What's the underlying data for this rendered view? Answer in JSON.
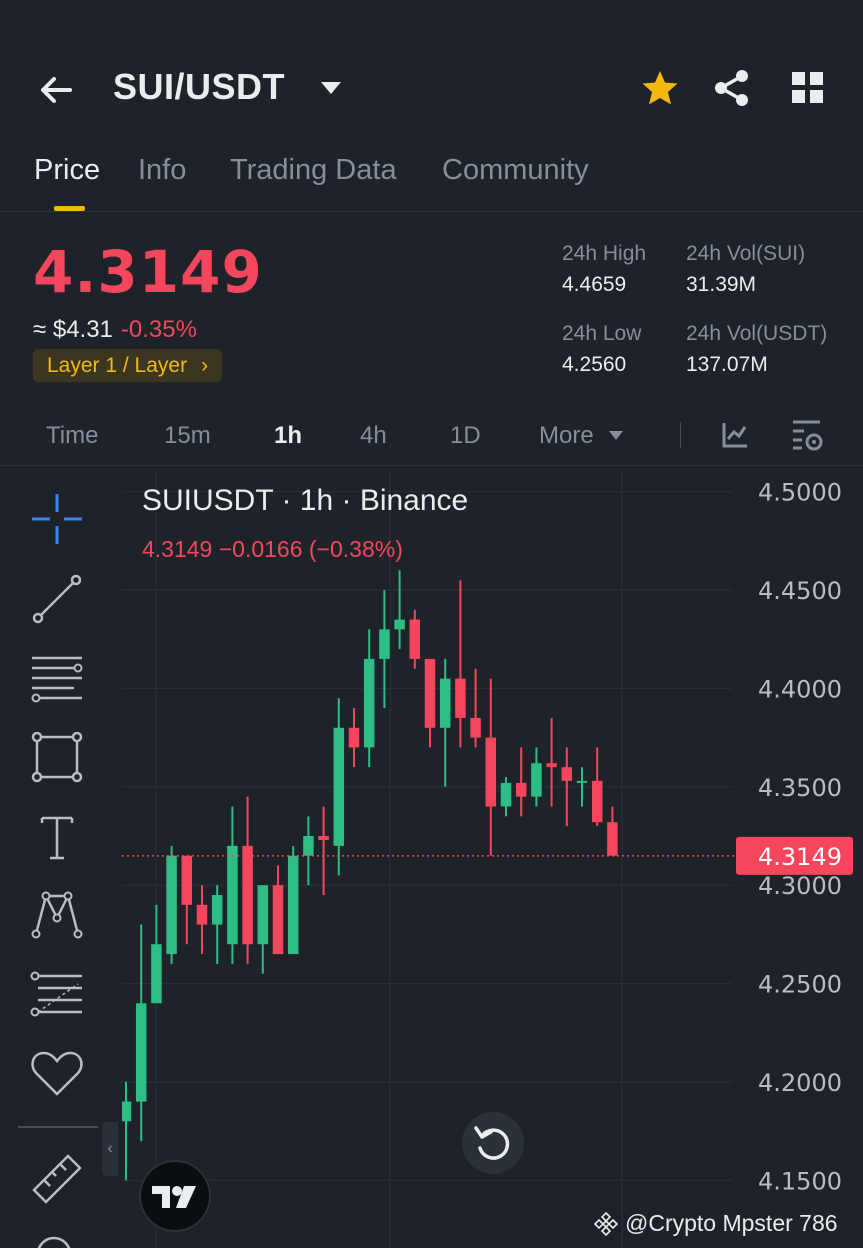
{
  "header": {
    "pair": "SUI/USDT",
    "icons": [
      "back-arrow-icon",
      "chevron-down-icon",
      "star-icon",
      "share-icon",
      "grid-icon"
    ]
  },
  "tabs": [
    "Price",
    "Info",
    "Trading Data",
    "Community"
  ],
  "ticker": {
    "last_price": "4.3149",
    "usd_equiv": "≈ $4.31",
    "change_pct": "-0.35%",
    "tag": "Layer 1 / Layer",
    "tag_arrow": "›",
    "high_label": "24h High",
    "high_value": "4.4659",
    "low_label": "24h Low",
    "low_value": "4.2560",
    "vol_sui_label": "24h Vol(SUI)",
    "vol_sui_value": "31.39M",
    "vol_usdt_label": "24h Vol(USDT)",
    "vol_usdt_value": "137.07M"
  },
  "intervals": {
    "items": [
      "Time",
      "15m",
      "1h",
      "4h",
      "1D",
      "More"
    ],
    "active": "1h"
  },
  "chart_header": {
    "title": "SUIUSDT · 1h · Binance",
    "ohlc_line": "4.3149  −0.0166 (−0.38%)"
  },
  "chart_data": {
    "type": "candlestick",
    "y_ticks": [
      "4.5000",
      "4.4500",
      "4.4000",
      "4.3500",
      "4.3000",
      "4.2500",
      "4.2000",
      "4.1500"
    ],
    "ylim": [
      4.14,
      4.51
    ],
    "last_price_label": "4.3149",
    "last_price": 4.3149,
    "candles": [
      {
        "o": 4.18,
        "h": 4.2,
        "l": 4.15,
        "c": 4.19
      },
      {
        "o": 4.19,
        "h": 4.28,
        "l": 4.17,
        "c": 4.24
      },
      {
        "o": 4.24,
        "h": 4.29,
        "l": 4.26,
        "c": 4.27
      },
      {
        "o": 4.265,
        "h": 4.32,
        "l": 4.26,
        "c": 4.315
      },
      {
        "o": 4.315,
        "h": 4.315,
        "l": 4.27,
        "c": 4.29
      },
      {
        "o": 4.29,
        "h": 4.3,
        "l": 4.265,
        "c": 4.28
      },
      {
        "o": 4.28,
        "h": 4.3,
        "l": 4.26,
        "c": 4.295
      },
      {
        "o": 4.27,
        "h": 4.34,
        "l": 4.26,
        "c": 4.32
      },
      {
        "o": 4.32,
        "h": 4.345,
        "l": 4.26,
        "c": 4.27
      },
      {
        "o": 4.27,
        "h": 4.3,
        "l": 4.255,
        "c": 4.3
      },
      {
        "o": 4.3,
        "h": 4.31,
        "l": 4.265,
        "c": 4.265
      },
      {
        "o": 4.265,
        "h": 4.32,
        "l": 4.265,
        "c": 4.315
      },
      {
        "o": 4.315,
        "h": 4.335,
        "l": 4.3,
        "c": 4.325
      },
      {
        "o": 4.325,
        "h": 4.34,
        "l": 4.295,
        "c": 4.323
      },
      {
        "o": 4.32,
        "h": 4.395,
        "l": 4.305,
        "c": 4.38
      },
      {
        "o": 4.38,
        "h": 4.39,
        "l": 4.36,
        "c": 4.37
      },
      {
        "o": 4.37,
        "h": 4.43,
        "l": 4.36,
        "c": 4.415
      },
      {
        "o": 4.415,
        "h": 4.45,
        "l": 4.39,
        "c": 4.43
      },
      {
        "o": 4.43,
        "h": 4.46,
        "l": 4.42,
        "c": 4.435
      },
      {
        "o": 4.435,
        "h": 4.44,
        "l": 4.41,
        "c": 4.415
      },
      {
        "o": 4.415,
        "h": 4.415,
        "l": 4.37,
        "c": 4.38
      },
      {
        "o": 4.38,
        "h": 4.415,
        "l": 4.35,
        "c": 4.405
      },
      {
        "o": 4.405,
        "h": 4.455,
        "l": 4.37,
        "c": 4.385
      },
      {
        "o": 4.385,
        "h": 4.41,
        "l": 4.37,
        "c": 4.375
      },
      {
        "o": 4.375,
        "h": 4.405,
        "l": 4.315,
        "c": 4.34
      },
      {
        "o": 4.34,
        "h": 4.355,
        "l": 4.335,
        "c": 4.352
      },
      {
        "o": 4.352,
        "h": 4.37,
        "l": 4.335,
        "c": 4.345
      },
      {
        "o": 4.345,
        "h": 4.37,
        "l": 4.34,
        "c": 4.362
      },
      {
        "o": 4.362,
        "h": 4.385,
        "l": 4.34,
        "c": 4.36
      },
      {
        "o": 4.36,
        "h": 4.37,
        "l": 4.33,
        "c": 4.353
      },
      {
        "o": 4.353,
        "h": 4.36,
        "l": 4.34,
        "c": 4.353
      },
      {
        "o": 4.353,
        "h": 4.37,
        "l": 4.33,
        "c": 4.332
      },
      {
        "o": 4.332,
        "h": 4.34,
        "l": 4.315,
        "c": 4.315
      }
    ],
    "colors": {
      "up": "#2ebd85",
      "down": "#f6465d",
      "grid": "#2b3139",
      "axis_text": "#b7bdc6"
    }
  },
  "watermark": "@Crypto Mpster 786"
}
